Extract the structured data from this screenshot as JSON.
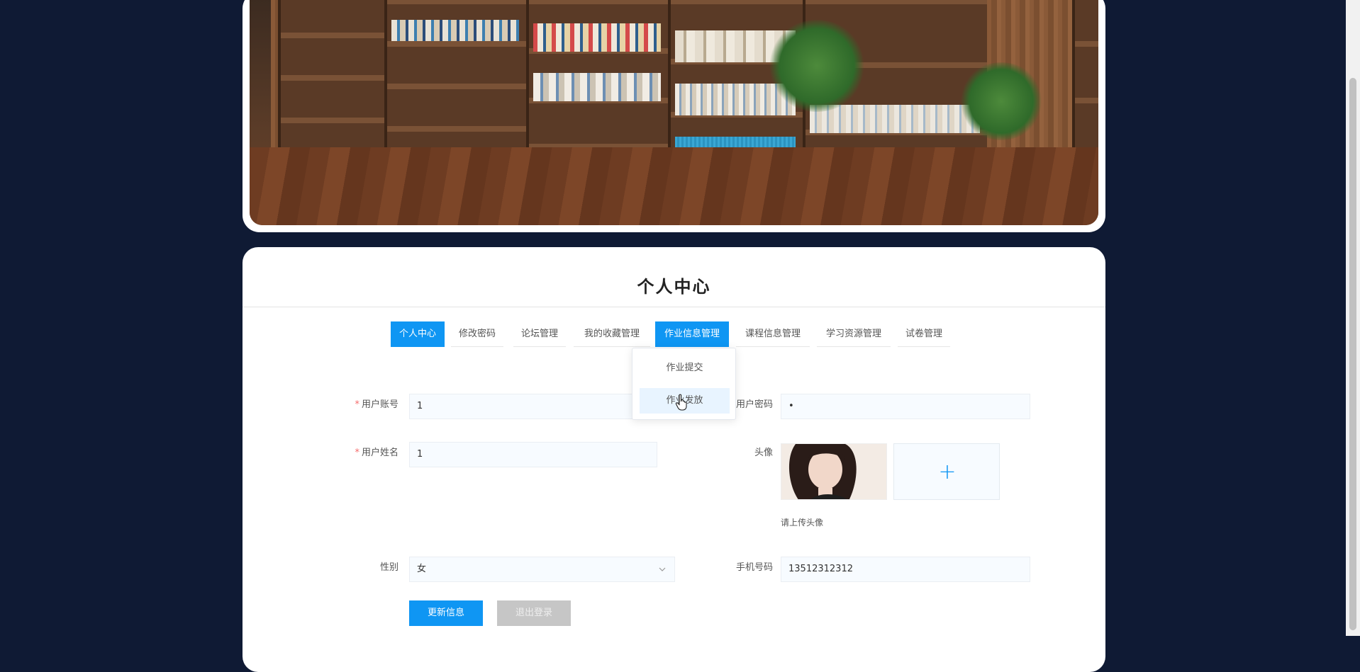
{
  "page": {
    "title": "个人中心"
  },
  "tabs": [
    {
      "label": "个人中心",
      "active": true
    },
    {
      "label": "修改密码",
      "active": false
    },
    {
      "label": "论坛管理",
      "active": false
    },
    {
      "label": "我的收藏管理",
      "active": false
    },
    {
      "label": "作业信息管理",
      "active": true
    },
    {
      "label": "课程信息管理",
      "active": false
    },
    {
      "label": "学习资源管理",
      "active": false
    },
    {
      "label": "试卷管理",
      "active": false
    }
  ],
  "dropdown": {
    "items": [
      "作业提交",
      "作业发放"
    ],
    "hovered": "作业发放"
  },
  "form": {
    "account_label": "用户账号",
    "account_value": "1",
    "password_label": "用户密码",
    "password_value": "•",
    "name_label": "用户姓名",
    "name_value": "1",
    "avatar_label": "头像",
    "avatar_hint": "请上传头像",
    "gender_label": "性别",
    "gender_value": "女",
    "phone_label": "手机号码",
    "phone_value": "13512312312",
    "required_mark": "*",
    "upload_plus": "+"
  },
  "buttons": {
    "update": "更新信息",
    "logout": "退出登录"
  },
  "colors": {
    "accent": "#0f96f3",
    "background": "#0f1a34",
    "required": "#f56c6c"
  },
  "icons": {
    "select_arrow": "chevron-down-icon",
    "upload": "plus-icon",
    "cursor": "hand-pointer-icon"
  }
}
